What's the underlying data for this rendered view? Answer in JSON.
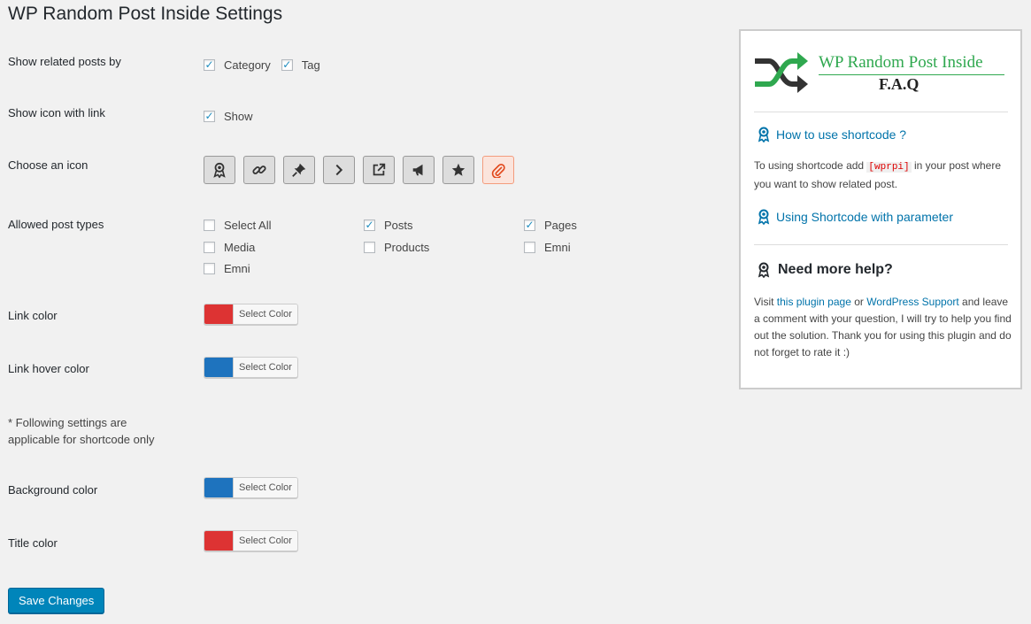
{
  "page_title": "WP Random Post Inside Settings",
  "settings": {
    "related_by": {
      "label": "Show related posts by",
      "options": [
        {
          "label": "Category",
          "checked": true
        },
        {
          "label": "Tag",
          "checked": true
        }
      ]
    },
    "show_icon": {
      "label": "Show icon with link",
      "option": {
        "label": "Show",
        "checked": true
      }
    },
    "choose_icon": {
      "label": "Choose an icon",
      "icons": [
        "award-icon",
        "link-icon",
        "pin-icon",
        "chevron-right-icon",
        "external-link-icon",
        "megaphone-icon",
        "star-icon",
        "paperclip-icon"
      ],
      "selected": "paperclip-icon"
    },
    "post_types": {
      "label": "Allowed post types",
      "options": [
        {
          "label": "Select All",
          "checked": false
        },
        {
          "label": "Posts",
          "checked": true
        },
        {
          "label": "Pages",
          "checked": true
        },
        {
          "label": "Media",
          "checked": false
        },
        {
          "label": "Products",
          "checked": false
        },
        {
          "label": "Emni",
          "checked": false
        },
        {
          "label": "Emni",
          "checked": false
        }
      ]
    },
    "link_color": {
      "label": "Link color",
      "color": "#dd3333",
      "button": "Select Color"
    },
    "link_hover_color": {
      "label": "Link hover color",
      "color": "#1e73be",
      "button": "Select Color"
    },
    "note": "* Following settings are applicable for shortcode only",
    "background_color": {
      "label": "Background color",
      "color": "#1e73be",
      "button": "Select Color"
    },
    "title_color": {
      "label": "Title color",
      "color": "#dd3333",
      "button": "Select Color"
    },
    "save_label": "Save Changes"
  },
  "faq": {
    "brand": "WP Random Post Inside",
    "subtitle": "F.A.Q",
    "link1": "How to use shortcode ?",
    "text1_before": "To using shortcode add ",
    "text1_code": "[wprpi]",
    "text1_after": " in your post where you want to show related post.",
    "link2": "Using Shortcode with parameter",
    "help_title": "Need more help?",
    "help_visit": "Visit ",
    "help_link1": "this plugin page",
    "help_or": " or ",
    "help_link2": "WordPress Support",
    "help_rest": " and leave a comment with your question, I will try to help you find out the solution. Thank you for using this plugin and do not forget to rate it :)"
  },
  "colors": {
    "primary": "#0085ba",
    "link": "#0073aa",
    "brand_green": "#2fa84f"
  }
}
